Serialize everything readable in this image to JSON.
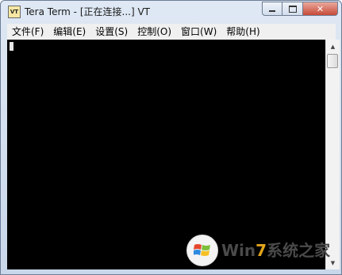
{
  "window": {
    "icon_text": "VT",
    "title": "Tera Term - [正在连接...] VT"
  },
  "menu": {
    "items": [
      "文件(F)",
      "编辑(E)",
      "设置(S)",
      "控制(O)",
      "窗口(W)",
      "帮助(H)"
    ]
  },
  "watermark": {
    "brand_prefix": "Win",
    "brand_number": "7",
    "brand_suffix": "系统之家"
  },
  "colors": {
    "terminal_bg": "#000000",
    "close_button": "#c74a38",
    "watermark_accent": "#e2a51b"
  }
}
